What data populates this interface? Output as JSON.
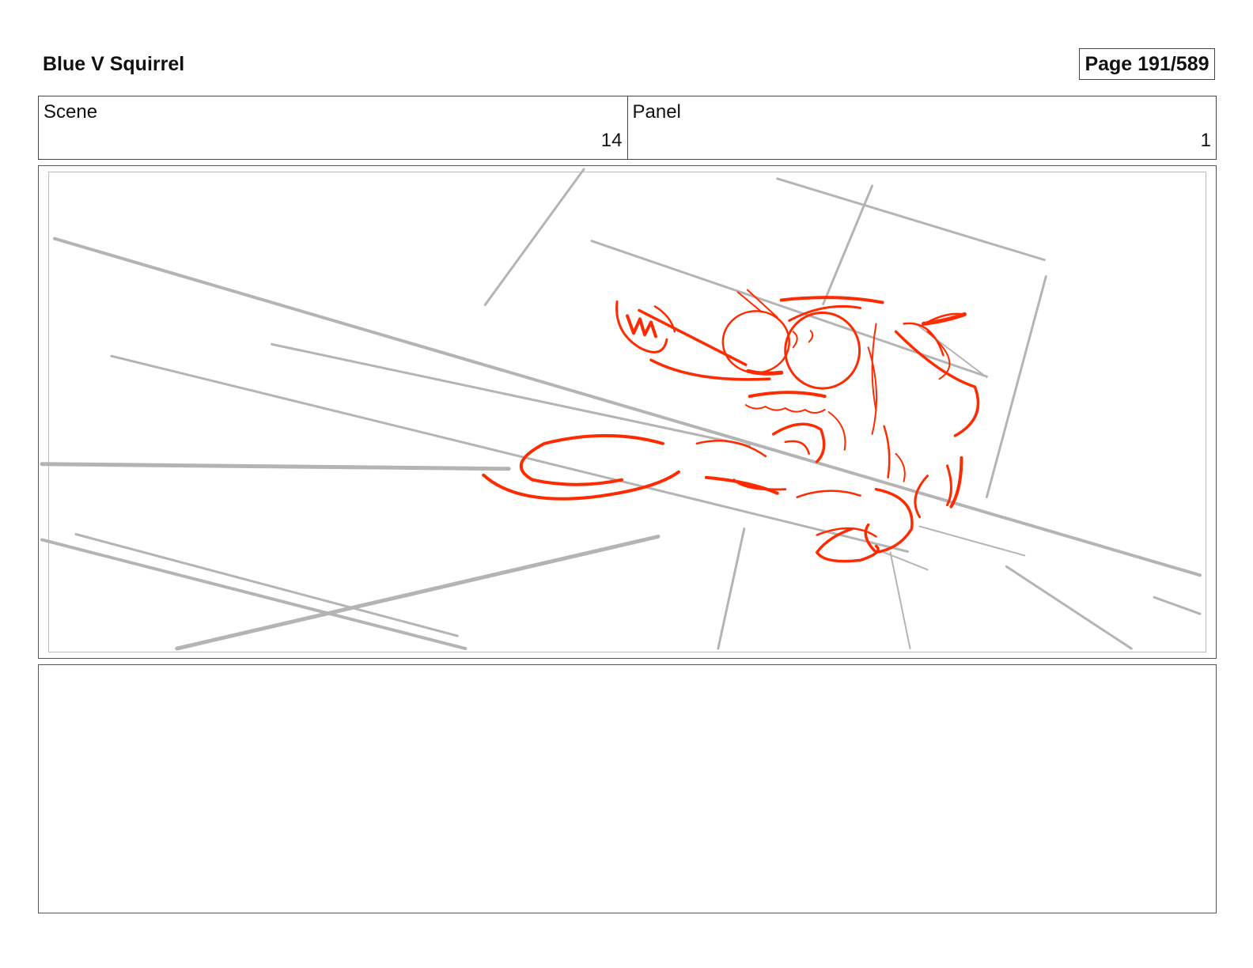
{
  "document": {
    "title": "Blue V Squirrel",
    "page_label": "Page 191/589"
  },
  "info": {
    "scene_label": "Scene",
    "scene_value": "14",
    "panel_label": "Panel",
    "panel_value": "1"
  },
  "sketch": {
    "line_color": "#b4b4b4",
    "character_color": "#ff2a00"
  },
  "notes": {
    "text": ""
  }
}
